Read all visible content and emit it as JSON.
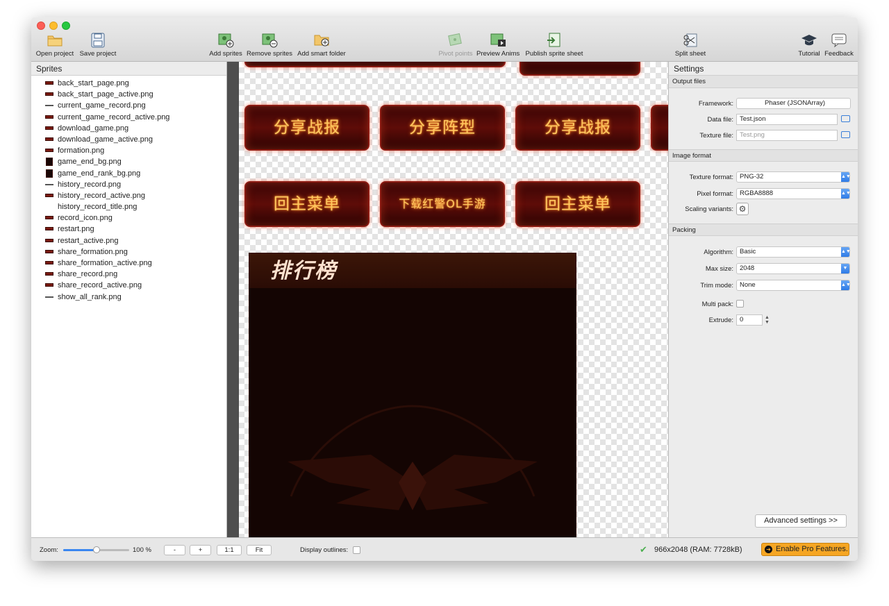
{
  "toolbar": {
    "open_project": "Open project",
    "save_project": "Save project",
    "add_sprites": "Add sprites",
    "remove_sprites": "Remove sprites",
    "add_smart_folder": "Add smart folder",
    "pivot_points": "Pivot points",
    "preview_anims": "Preview Anims",
    "publish_sprite_sheet": "Publish sprite sheet",
    "split_sheet": "Split sheet",
    "tutorial": "Tutorial",
    "feedback": "Feedback"
  },
  "sprites_panel": {
    "title": "Sprites",
    "items": [
      "back_start_page.png",
      "back_start_page_active.png",
      "current_game_record.png",
      "current_game_record_active.png",
      "download_game.png",
      "download_game_active.png",
      "formation.png",
      "game_end_bg.png",
      "game_end_rank_bg.png",
      "history_record.png",
      "history_record_active.png",
      "history_record_title.png",
      "record_icon.png",
      "restart.png",
      "restart_active.png",
      "share_formation.png",
      "share_formation_active.png",
      "share_record.png",
      "share_record_active.png",
      "show_all_rank.png"
    ]
  },
  "canvas": {
    "sprite_labels": [
      "分享战报",
      "分享阵型",
      "分享战报",
      "回主菜单",
      "下载红警OL手游",
      "回主菜单"
    ],
    "rank_title": "排行榜"
  },
  "settings": {
    "title": "Settings",
    "output_files": {
      "section": "Output files",
      "framework_label": "Framework:",
      "framework_value": "Phaser (JSONArray)",
      "data_file_label": "Data file:",
      "data_file_value": "Test.json",
      "texture_file_label": "Texture file:",
      "texture_file_placeholder": "Test.png"
    },
    "image_format": {
      "section": "Image format",
      "texture_format_label": "Texture format:",
      "texture_format_value": "PNG-32",
      "pixel_format_label": "Pixel format:",
      "pixel_format_value": "RGBA8888",
      "scaling_variants_label": "Scaling variants:"
    },
    "packing": {
      "section": "Packing",
      "algorithm_label": "Algorithm:",
      "algorithm_value": "Basic",
      "max_size_label": "Max size:",
      "max_size_value": "2048",
      "trim_mode_label": "Trim mode:",
      "trim_mode_value": "None",
      "multi_pack_label": "Multi pack:",
      "extrude_label": "Extrude:",
      "extrude_value": "0"
    },
    "advanced_button": "Advanced settings >>"
  },
  "bottom": {
    "zoom_label": "Zoom:",
    "zoom_value": "100 %",
    "zoom_level": 0.5,
    "minus": "-",
    "plus": "+",
    "one_to_one": "1:1",
    "fit": "Fit",
    "display_outlines": "Display outlines:",
    "status": "966x2048 (RAM: 7728kB)",
    "pro_button": "Enable Pro Features."
  },
  "colors": {
    "accent_blue": "#2b78e6",
    "pro_orange": "#f6a623",
    "status_green": "#4caf50"
  }
}
